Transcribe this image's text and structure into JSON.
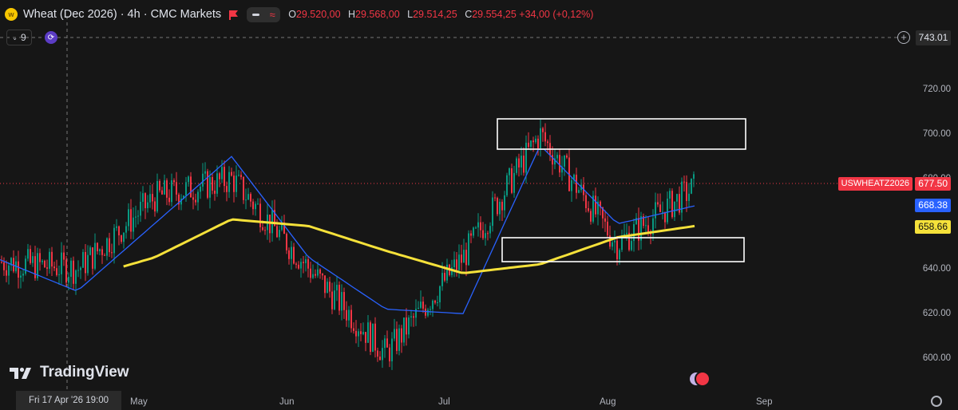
{
  "header": {
    "symbol_icon": "wheat-icon",
    "title": "Wheat (Dec 2026) · 4h · CMC Markets",
    "ohlc": [
      {
        "key": "O",
        "value": "29.520,00"
      },
      {
        "key": "H",
        "value": "29.568,00"
      },
      {
        "key": "L",
        "value": "29.514,25"
      },
      {
        "key": "C",
        "value": "29.554,25 +34,00 (+0,12%)"
      }
    ],
    "indicator_count": "9"
  },
  "price_axis": {
    "labels": [
      "720.00",
      "700.00",
      "680.00",
      "640.00",
      "620.00",
      "600.00"
    ],
    "top_value": "743.01",
    "last_price": "677.50",
    "symbol_tag": "USWHEATZ2026",
    "ma_blue_value": "668.38",
    "ma_yellow_value": "658.66"
  },
  "time_axis": {
    "crosshair_time": "Fri 17 Apr '26   19:00",
    "months": [
      "May",
      "Jun",
      "Jul",
      "Aug",
      "Sep"
    ]
  },
  "branding": {
    "logo_text": "TradingView"
  },
  "colors": {
    "background": "#161616",
    "up": "#089981",
    "down": "#f23645",
    "ma_blue": "#2962ff",
    "ma_yellow": "#f5e13a",
    "price_tag_blue": "#2962ff",
    "price_tag_yellow": "#f5e13a",
    "price_tag_red": "#f23645"
  },
  "chart_data": {
    "type": "line",
    "title": "",
    "xlabel": "",
    "ylabel": "",
    "ylim": [
      590,
      745
    ],
    "x": [
      "Apr 17",
      "May 1",
      "May 15",
      "Jun 1",
      "Jun 15",
      "Jul 1",
      "Jul 15",
      "Aug 1",
      "Aug 15",
      "Aug 24"
    ],
    "series": [
      {
        "values": [
          643,
          640,
          672,
          680,
          640,
          602,
          645,
          700,
          651,
          676
        ]
      },
      {
        "values": [
          644,
          630,
          660,
          690,
          645,
          622,
          620,
          695,
          660,
          668
        ]
      },
      {
        "values": [
          null,
          null,
          645,
          662,
          659,
          648,
          638,
          642,
          654,
          659
        ]
      }
    ],
    "zones": [
      {
        "low": 694,
        "high": 706
      },
      {
        "low": 643,
        "high": 653
      }
    ],
    "grid": false
  }
}
